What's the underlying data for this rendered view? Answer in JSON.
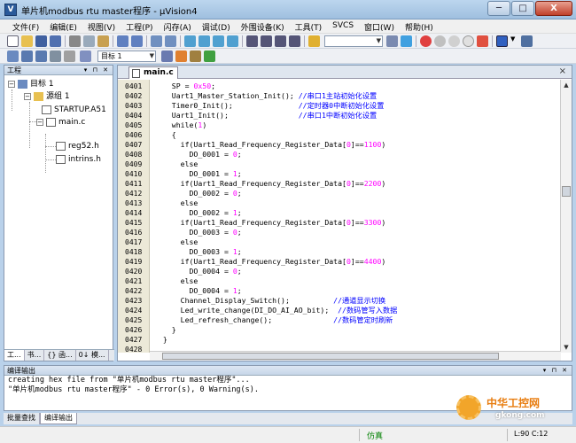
{
  "window": {
    "title": "单片机modbus rtu master程序 - µVision4",
    "minimize_label": "─",
    "maximize_label": "□",
    "close_label": "X",
    "app_icon_label": "V"
  },
  "menu": {
    "items": [
      "文件(F)",
      "编辑(E)",
      "视图(V)",
      "工程(P)",
      "闪存(A)",
      "调试(D)",
      "外围设备(K)",
      "工具(T)",
      "SVCS",
      "窗口(W)",
      "帮助(H)"
    ]
  },
  "toolbar": {
    "target_combo": "目标 1"
  },
  "project_panel": {
    "title": "工程",
    "tree": {
      "target": "目标 1",
      "group": "源组 1",
      "files": [
        "STARTUP.A51",
        "main.c"
      ],
      "includes": [
        "reg52.h",
        "intrins.h"
      ]
    },
    "tabs": [
      "工...",
      "书...",
      "{} 函...",
      "0↓ 模..."
    ]
  },
  "editor": {
    "tab_label": "main.c",
    "close_label": "×",
    "lines": [
      {
        "n": "0401",
        "code": "   SP = 0x50;",
        "comment": ""
      },
      {
        "n": "0402",
        "code": "   Uart1_Master_Station_Init(); ",
        "comment": "//串口1主站初始化设置"
      },
      {
        "n": "0403",
        "code": "   Timer0_Init();               ",
        "comment": "//定时器0中断初始化设置"
      },
      {
        "n": "0404",
        "code": "   Uart1_Init();                ",
        "comment": "//串口1中断初始化设置"
      },
      {
        "n": "0405",
        "code": "   while(1)",
        "comment": ""
      },
      {
        "n": "0406",
        "code": "   {",
        "comment": ""
      },
      {
        "n": "0407",
        "code": "     if(Uart1_Read_Frequency_Register_Data[0]==1100)",
        "comment": ""
      },
      {
        "n": "0408",
        "code": "       DO_0001 = 0;",
        "comment": ""
      },
      {
        "n": "0409",
        "code": "     else",
        "comment": ""
      },
      {
        "n": "0410",
        "code": "       DO_0001 = 1;",
        "comment": ""
      },
      {
        "n": "0411",
        "code": "     if(Uart1_Read_Frequency_Register_Data[0]==2200)",
        "comment": ""
      },
      {
        "n": "0412",
        "code": "       DO_0002 = 0;",
        "comment": ""
      },
      {
        "n": "0413",
        "code": "     else",
        "comment": ""
      },
      {
        "n": "0414",
        "code": "       DO_0002 = 1;",
        "comment": ""
      },
      {
        "n": "0415",
        "code": "     if(Uart1_Read_Frequency_Register_Data[0]==3300)",
        "comment": ""
      },
      {
        "n": "0416",
        "code": "       DO_0003 = 0;",
        "comment": ""
      },
      {
        "n": "0417",
        "code": "     else",
        "comment": ""
      },
      {
        "n": "0418",
        "code": "       DO_0003 = 1;",
        "comment": ""
      },
      {
        "n": "0419",
        "code": "     if(Uart1_Read_Frequency_Register_Data[0]==4400)",
        "comment": ""
      },
      {
        "n": "0420",
        "code": "       DO_0004 = 0;",
        "comment": ""
      },
      {
        "n": "0421",
        "code": "     else",
        "comment": ""
      },
      {
        "n": "0422",
        "code": "       DO_0004 = 1;",
        "comment": ""
      },
      {
        "n": "0423",
        "code": "     Channel_Display_Switch();          ",
        "comment": "//通道显示切换"
      },
      {
        "n": "0424",
        "code": "     Led_write_change(DI_DO_AI_AO_bit);  ",
        "comment": "//数码管写入数据"
      },
      {
        "n": "0425",
        "code": "     Led_refresh_change();              ",
        "comment": "//数码管定时刷新"
      },
      {
        "n": "0426",
        "code": "   }",
        "comment": ""
      },
      {
        "n": "0427",
        "code": " }",
        "comment": ""
      },
      {
        "n": "0428",
        "code": "",
        "comment": ""
      }
    ]
  },
  "output_panel": {
    "title": "编译输出",
    "lines": [
      "creating hex file from \"单片机modbus rtu master程序\"...",
      "\"单片机modbus rtu master程序\" - 0 Error(s), 0 Warning(s)."
    ],
    "tabs": [
      "批量查找",
      "编译输出"
    ]
  },
  "statusbar": {
    "mode": "仿真",
    "position": "L:90 C:12"
  },
  "watermark": {
    "name": "中华工控网",
    "url": "gkong.com"
  }
}
